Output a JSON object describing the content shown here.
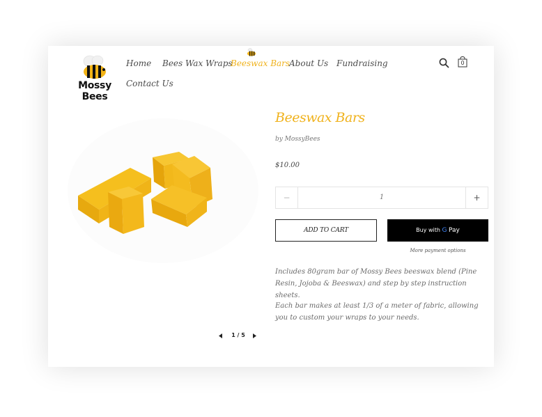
{
  "brand": {
    "name": "Mossy Bees"
  },
  "nav": {
    "items": [
      {
        "label": "Home"
      },
      {
        "label": "Bees Wax Wraps"
      },
      {
        "label": "Beeswax Bars"
      },
      {
        "label": "About Us"
      },
      {
        "label": "Fundraising"
      },
      {
        "label": "Contact Us"
      }
    ],
    "active_index": 2
  },
  "header": {
    "search_icon": "search-icon",
    "cart_icon": "shopping-bag-icon",
    "cart_count": "0"
  },
  "gallery": {
    "counter": "1 / 5"
  },
  "product": {
    "title": "Beeswax Bars",
    "vendor": "by MossyBees",
    "price": "$10.00",
    "quantity": "1",
    "minus": "−",
    "plus": "+",
    "add_to_cart": "ADD TO CART",
    "buy_now": "Buy with",
    "buy_now_brand": "Pay",
    "more_options": "More payment options",
    "description": [
      "Includes 80gram bar of Mossy Bees beeswax blend (Pine Resin, Jojoba & Beeswax) and step by step instruction sheets.",
      "Each bar makes at least 1/3 of a meter of fabric, allowing you to custom your wraps to your needs."
    ]
  },
  "colors": {
    "accent": "#f0b21c",
    "text": "#4b4b4b",
    "button_dark": "#000000"
  }
}
